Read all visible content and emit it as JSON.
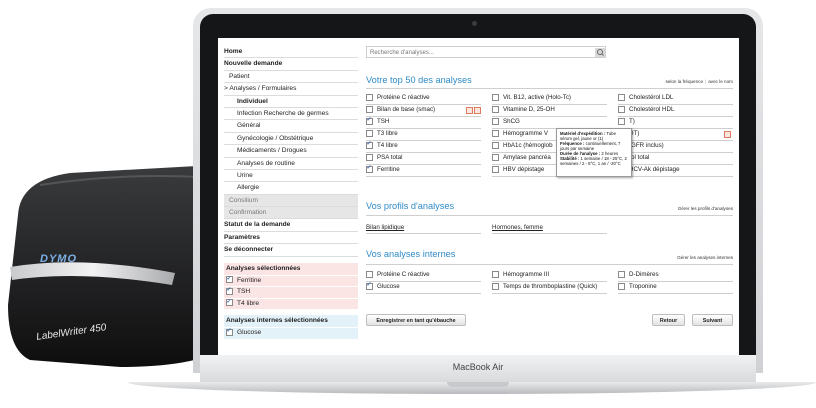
{
  "printer": {
    "brand": "DYMO",
    "model": "LabelWriter 450"
  },
  "laptop": {
    "brand": "MacBook Air"
  },
  "search": {
    "placeholder": "Recherche d'analyses..."
  },
  "sidebar": {
    "items": [
      {
        "label": "Home"
      },
      {
        "label": "Nouvelle demande"
      },
      {
        "label": "Patient"
      },
      {
        "label": "> Analyses / Formulaires"
      },
      {
        "label": "Individuel"
      },
      {
        "label": "Infection Recherche de germes"
      },
      {
        "label": "Général"
      },
      {
        "label": "Gynécologie / Obstétrique"
      },
      {
        "label": "Médicaments / Drogues"
      },
      {
        "label": "Analyses de routine"
      },
      {
        "label": "Urine"
      },
      {
        "label": "Allergie"
      },
      {
        "label": "Consilium"
      },
      {
        "label": "Confirmation"
      },
      {
        "label": "Statut de la demande"
      },
      {
        "label": "Paramètres"
      },
      {
        "label": "Se déconnecter"
      }
    ]
  },
  "selected_panel": {
    "title": "Analyses sélectionnées",
    "items": [
      {
        "label": "Ferritine"
      },
      {
        "label": "TSH"
      },
      {
        "label": "T4 libre"
      }
    ]
  },
  "internal_panel": {
    "title": "Analyses internes sélectionnées",
    "items": [
      {
        "label": "Glucose"
      }
    ]
  },
  "top50": {
    "title": "Votre top 50 des analyses",
    "sort_frequency": "selon la fréquence",
    "sort_name": "avec le nom",
    "columns": [
      [
        {
          "label": "Protéine C réactive",
          "checked": false
        },
        {
          "label": "Bilan de base (smac)",
          "checked": false
        },
        {
          "label": "TSH",
          "checked": true
        },
        {
          "label": "T3 libre",
          "checked": false
        },
        {
          "label": "T4 libre",
          "checked": true
        },
        {
          "label": "PSA total",
          "checked": false
        },
        {
          "label": "Ferritine",
          "checked": true
        }
      ],
      [
        {
          "label": "Vit. B12, active (Holo-Tc)",
          "checked": false
        },
        {
          "label": "Vitamine D, 25-OH",
          "checked": false
        },
        {
          "label": "ShCG",
          "checked": false
        },
        {
          "label": "Hémogramme V",
          "checked": false
        },
        {
          "label": "HbA1c (hémoglob",
          "checked": false
        },
        {
          "label": "Amylase pancréa",
          "checked": false
        },
        {
          "label": "HBV dépistage",
          "checked": false
        }
      ],
      [
        {
          "label": "Cholestérol LDL",
          "checked": false
        },
        {
          "label": "Cholestérol HDL",
          "checked": false
        },
        {
          "label": "T)",
          "checked": false
        },
        {
          "label": "DT)",
          "checked": false
        },
        {
          "label": "(GFR inclus)",
          "checked": false
        },
        {
          "label": "rol total",
          "checked": false
        },
        {
          "label": "HCV-Ak dépistage",
          "checked": false
        }
      ]
    ]
  },
  "tooltip": {
    "material_label": "Matériel d'expédition :",
    "material_value": "Tube sérum gel, jaune or (1)",
    "frequency_label": "Fréquence :",
    "frequency_value": "continuellement, 7 jours par semaine",
    "duration_label": "Durée de l'analyse :",
    "duration_value": "2 heures",
    "stability_label": "Stabilité :",
    "stability_value": "1 semaine / 18 - 25°C, 2 semaines / 2 - 8°C, 1 an / -20°C"
  },
  "profiles": {
    "title": "Vos profils d'analyses",
    "manage": "Gérer les profils d'analyses",
    "items": [
      {
        "label": "Bilan lipidique"
      },
      {
        "label": "Hormones, femme"
      }
    ]
  },
  "internal": {
    "title": "Vos analyses internes",
    "manage": "Gérer les analyses internes",
    "items": [
      {
        "label": "Protéine C réactive",
        "checked": false
      },
      {
        "label": "Hémogramme III",
        "checked": false
      },
      {
        "label": "D-Dimères",
        "checked": false
      },
      {
        "label": "Glucose",
        "checked": true
      },
      {
        "label": "Temps de thromboplastine (Quick)",
        "checked": false
      },
      {
        "label": "Troponine",
        "checked": false
      }
    ]
  },
  "buttons": {
    "save_draft": "Enregistrer en tant qu'ébauche",
    "back": "Retour",
    "next": "Suivant"
  },
  "colors": {
    "accent": "#2f8bc8",
    "selected_panel": "#fbe4e4",
    "internal_panel": "#e3f1f8"
  }
}
